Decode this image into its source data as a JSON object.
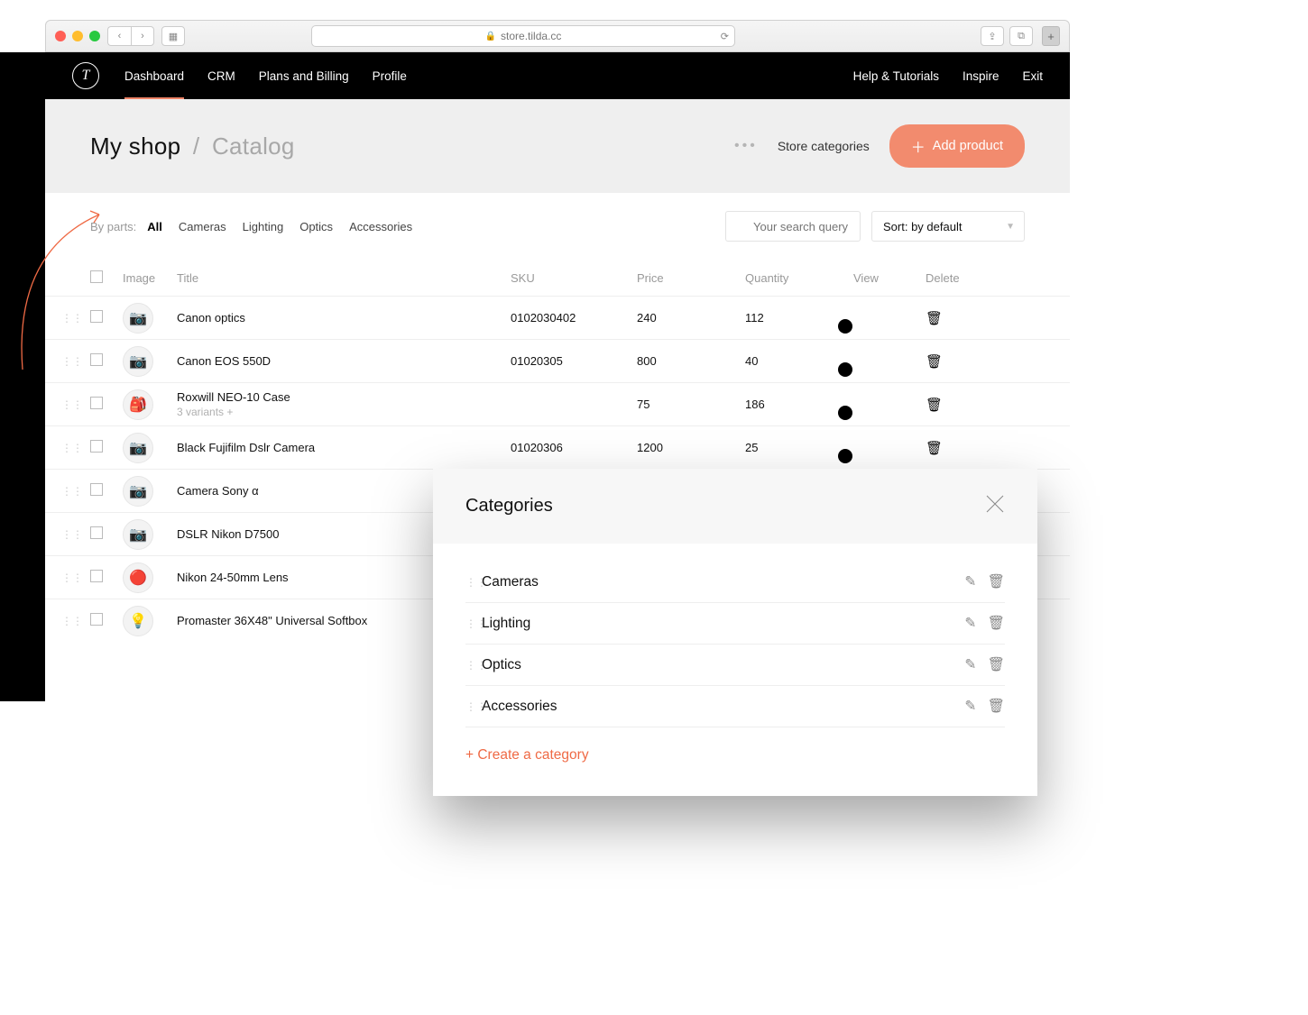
{
  "browser": {
    "url": "store.tilda.cc"
  },
  "nav": {
    "items": [
      "Dashboard",
      "CRM",
      "Plans and Billing",
      "Profile"
    ],
    "right": [
      "Help & Tutorials",
      "Inspire",
      "Exit"
    ]
  },
  "header": {
    "breadcrumb_root": "My shop",
    "breadcrumb_slash": "/",
    "breadcrumb_current": "Catalog",
    "store_categories": "Store categories",
    "add_product": "Add product"
  },
  "filters": {
    "label": "By parts:",
    "parts": [
      "All",
      "Cameras",
      "Lighting",
      "Optics",
      "Accessories"
    ],
    "search_placeholder": "Your search query",
    "sort_label": "Sort: by default"
  },
  "columns": {
    "image": "Image",
    "title": "Title",
    "sku": "SKU",
    "price": "Price",
    "quantity": "Quantity",
    "view": "View",
    "delete": "Delete"
  },
  "products": [
    {
      "title": "Canon optics",
      "sub": "",
      "sku": "0102030402",
      "price": "240",
      "qty": "112",
      "thumb": "📷"
    },
    {
      "title": "Canon EOS 550D",
      "sub": "",
      "sku": "01020305",
      "price": "800",
      "qty": "40",
      "thumb": "📷"
    },
    {
      "title": "Roxwill NEO-10 Case",
      "sub": "3 variants +",
      "sku": "",
      "price": "75",
      "qty": "186",
      "thumb": "🎒"
    },
    {
      "title": "Black Fujifilm Dslr Camera",
      "sub": "",
      "sku": "01020306",
      "price": "1200",
      "qty": "25",
      "thumb": "📷"
    },
    {
      "title": "Camera Sony α",
      "sub": "",
      "sku": "",
      "price": "",
      "qty": "",
      "thumb": "📷"
    },
    {
      "title": "DSLR Nikon D7500",
      "sub": "",
      "sku": "",
      "price": "",
      "qty": "",
      "thumb": "📷"
    },
    {
      "title": "Nikon 24-50mm Lens",
      "sub": "",
      "sku": "",
      "price": "",
      "qty": "",
      "thumb": "🔴"
    },
    {
      "title": "Promaster 36X48\" Universal Softbox",
      "sub": "",
      "sku": "",
      "price": "",
      "qty": "",
      "thumb": "💡"
    }
  ],
  "modal": {
    "title": "Categories",
    "categories": [
      "Cameras",
      "Lighting",
      "Optics",
      "Accessories"
    ],
    "create": "+ Create a category"
  }
}
